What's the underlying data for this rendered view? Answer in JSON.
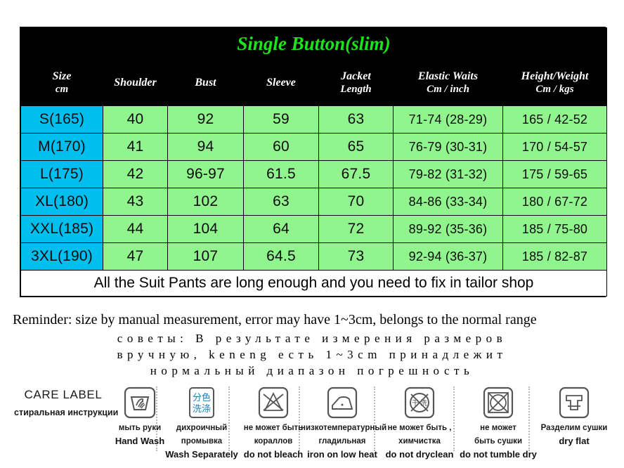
{
  "chart": {
    "title": "Single Button(slim)",
    "title_color": "#19E619",
    "header_bg": "#000000",
    "size_col_color": "#00BFEF",
    "data_cell_color": "#90F58C",
    "headers": [
      {
        "main": "Size",
        "sub": "cm"
      },
      {
        "main": "Shoulder",
        "sub": ""
      },
      {
        "main": "Bust",
        "sub": ""
      },
      {
        "main": "Sleeve",
        "sub": ""
      },
      {
        "main": "Jacket",
        "sub": "Length"
      },
      {
        "main": "Elastic Waits",
        "sub": "Cm / inch"
      },
      {
        "main": "Height/Weight",
        "sub": "Cm / kgs"
      }
    ],
    "rows": [
      {
        "size": "S(165)",
        "shoulder": "40",
        "bust": "92",
        "sleeve": "59",
        "jacket_length": "63",
        "elastic_waist": "71-74 (28-29)",
        "height_weight": "165 / 42-52"
      },
      {
        "size": "M(170)",
        "shoulder": "41",
        "bust": "94",
        "sleeve": "60",
        "jacket_length": "65",
        "elastic_waist": "76-79 (30-31)",
        "height_weight": "170 /  54-57"
      },
      {
        "size": "L(175)",
        "shoulder": "42",
        "bust": "96-97",
        "sleeve": "61.5",
        "jacket_length": "67.5",
        "elastic_waist": "79-82 (31-32)",
        "height_weight": "175 / 59-65"
      },
      {
        "size": "XL(180)",
        "shoulder": "43",
        "bust": "102",
        "sleeve": "63",
        "jacket_length": "70",
        "elastic_waist": "84-86 (33-34)",
        "height_weight": "180 / 67-72"
      },
      {
        "size": "XXL(185)",
        "shoulder": "44",
        "bust": "104",
        "sleeve": "64",
        "jacket_length": "72",
        "elastic_waist": "89-92 (35-36)",
        "height_weight": "185 / 75-80"
      },
      {
        "size": "3XL(190)",
        "shoulder": "47",
        "bust": "107",
        "sleeve": "64.5",
        "jacket_length": "73",
        "elastic_waist": "92-94 (36-37)",
        "height_weight": "185 / 82-87"
      }
    ],
    "footnote": "All the Suit Pants are long enough and you need to fix in tailor shop"
  },
  "reminder": "Reminder: size by manual measurement, error may have 1~3cm, belongs to the normal range",
  "russian_note": {
    "line1": "советы: В результате измерения размеров",
    "line2": "вручную, keneng есть 1~3cm принадлежит",
    "line3": "нормальный диапазон погрешность"
  },
  "care_label": {
    "title": "CARE LABEL",
    "subtitle": "стиральная инструкции",
    "items": [
      {
        "icon": "hand-wash-icon",
        "ru1": "мыть руки",
        "ru2": "",
        "en": "Hand Wash"
      },
      {
        "icon": "wash-separately-icon",
        "ru1": "дихроичный",
        "ru2": "промывка",
        "en": "Wash Separately"
      },
      {
        "icon": "do-not-bleach-icon",
        "ru1": "не  может быть",
        "ru2": "кораллов",
        "en": "do not bleach"
      },
      {
        "icon": "iron-low-heat-icon",
        "ru1": "низкотемпературный",
        "ru2": "гладильная",
        "en": "iron on low heat"
      },
      {
        "icon": "do-not-dryclean-icon",
        "ru1": "не может быть ,",
        "ru2": "химчистка",
        "en": "do not dryclean"
      },
      {
        "icon": "do-not-tumble-dry-icon",
        "ru1": "не  может",
        "ru2": "быть сушки",
        "en": "do not tumble dry"
      },
      {
        "icon": "dry-flat-icon",
        "ru1": "Разделим  сушки",
        "ru2": "",
        "en": "dry flat"
      }
    ],
    "wash_separately_glyph": "分色\n洗涤",
    "dryclean_glyph": "干洗"
  }
}
